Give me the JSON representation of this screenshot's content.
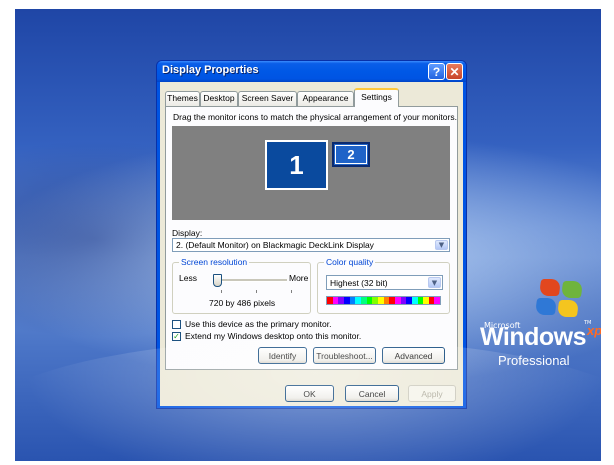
{
  "desktop": {
    "logo": {
      "brand_prefix": "Microsoft",
      "brand": "Windows",
      "xp": "xp",
      "tm": "TM",
      "edition": "Professional"
    }
  },
  "dialog": {
    "title": "Display Properties",
    "help_button": "?",
    "close_button": "✕",
    "tabs": [
      {
        "label": "Themes",
        "active": false
      },
      {
        "label": "Desktop",
        "active": false
      },
      {
        "label": "Screen Saver",
        "active": false
      },
      {
        "label": "Appearance",
        "active": false
      },
      {
        "label": "Settings",
        "active": true
      }
    ],
    "settings": {
      "instruction": "Drag the monitor icons to match the physical arrangement of your monitors.",
      "monitors": [
        {
          "number": "1",
          "selected": false
        },
        {
          "number": "2",
          "selected": true
        }
      ],
      "display_label": "Display:",
      "display_value": "2. (Default Monitor) on Blackmagic DeckLink Display",
      "screen_resolution": {
        "title": "Screen resolution",
        "less": "Less",
        "more": "More",
        "value": "720 by 486 pixels",
        "slider_fraction": 0
      },
      "color_quality": {
        "title": "Color quality",
        "value": "Highest (32 bit)",
        "spectrum_colors": [
          "#ff0000",
          "#ff00ff",
          "#8000ff",
          "#0000ff",
          "#0080ff",
          "#00ffff",
          "#00ff80",
          "#00ff00",
          "#80ff00",
          "#ffff00",
          "#ff8000",
          "#ff0000",
          "#ff00ff",
          "#8000ff",
          "#0000ff",
          "#00ffff",
          "#00ff00",
          "#ffff00",
          "#ff0000",
          "#ff00ff"
        ]
      },
      "primary_monitor_checkbox": {
        "label": "Use this device as the primary monitor.",
        "checked": false
      },
      "extend_desktop_checkbox": {
        "label": "Extend my Windows desktop onto this monitor.",
        "checked": true
      },
      "identify_button": "Identify",
      "troubleshoot_button": "Troubleshoot...",
      "advanced_button": "Advanced"
    },
    "ok_button": "OK",
    "cancel_button": "Cancel",
    "apply_button": "Apply"
  }
}
